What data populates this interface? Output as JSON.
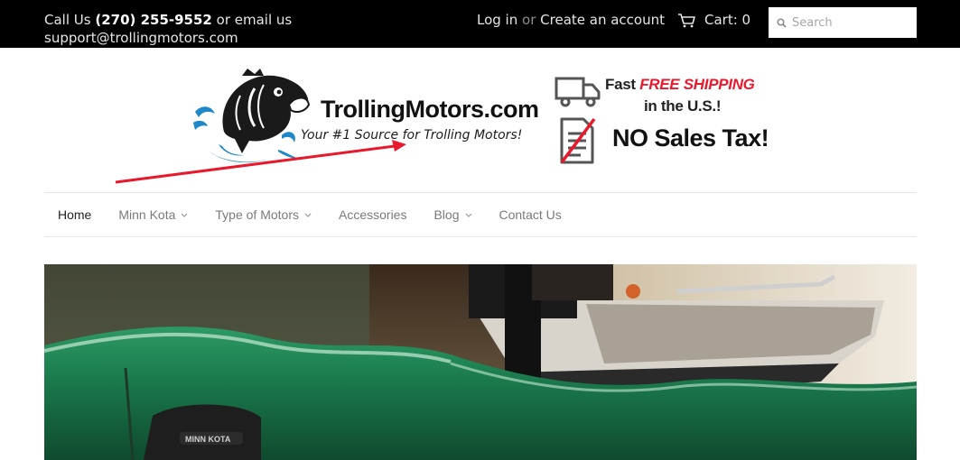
{
  "topbar": {
    "contact_prefix": "Call Us",
    "phone": "(270) 255-9552",
    "contact_mid": "or email us",
    "email": "support@trollingmotors.com",
    "login": "Log in",
    "or": "or",
    "create_account": "Create an account",
    "cart_label": "Cart: 0",
    "search_placeholder": "Search"
  },
  "header": {
    "logo_name": "TrollingMotors.com",
    "logo_tagline": "Your #1 Source for Trolling Motors!",
    "shipping_fast": "Fast",
    "shipping_free": "FREE SHIPPING",
    "shipping_line2": "in the U.S.!",
    "tax_text": "NO Sales Tax!"
  },
  "nav": {
    "items": [
      {
        "label": "Home",
        "active": true
      },
      {
        "label": "Minn Kota",
        "dropdown": true
      },
      {
        "label": "Type of Motors",
        "dropdown": true
      },
      {
        "label": "Accessories"
      },
      {
        "label": "Blog",
        "dropdown": true
      },
      {
        "label": "Contact Us"
      }
    ]
  },
  "hero": {
    "motor_brand": "MINN KOTA"
  },
  "colors": {
    "topbar_bg": "#000000",
    "accent_red": "#e8192c",
    "logo_blue": "#1e88c8",
    "water_green": "#1a7a4c"
  }
}
